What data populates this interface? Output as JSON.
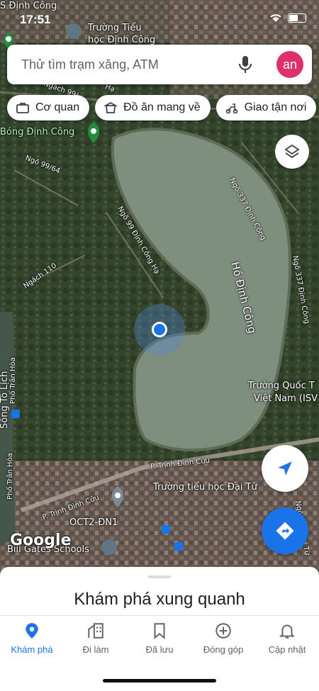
{
  "status_bar": {
    "time": "17:51"
  },
  "search": {
    "placeholder": "Thử tìm trạm xăng, ATM",
    "avatar_initials": "an"
  },
  "chips": [
    {
      "label": "Cơ quan",
      "icon": "briefcase-icon"
    },
    {
      "label": "Đồ ăn mang về",
      "icon": "takeout-icon"
    },
    {
      "label": "Giao tận nơi",
      "icon": "scooter-icon"
    }
  ],
  "map": {
    "labels": {
      "top_street": "S Định Công",
      "school_top": "Trường Tiểu",
      "school_top_2": "học Định Công",
      "ngach_99": "Ngách 99/",
      "ngo_ha": "Hạ",
      "bong_dinh_cong": "Bóng Định Công",
      "ngo_99_64": "Ngõ 99/64",
      "ngo_337_a": "Ngõ 337 Định Công",
      "ngo_99_dinh_cong_ha": "Ngõ 99 Định Công Hạ",
      "ngach_110": "Ngách 110",
      "lake": "Hồ Định Công",
      "ngo_337_b": "Ngõ 337 Định Công",
      "school_intl_1": "Trường Quốc T",
      "school_intl_2": "Việt Nam (ISV",
      "pho_tran_hoa_1": "Phố Trần Hòa",
      "song_to_lich": "Sông Tô Lịch",
      "p_trinh_dinh_cuu_1": "P. Trịnh Đình Cửu",
      "school_dai_tu": "Trường tiểu học Đại Từ",
      "p_trinh_dinh_cuu_2": "P. Trịnh Đình Cửu",
      "pho_tran_hoa_2": "Phố Trần Hòa",
      "oct2": "OCT2-ĐN1",
      "bill_gates": "Bill Gates Schools",
      "ngo_dai_tu": "Ngõ 102 Đại Từ",
      "google": "Google"
    }
  },
  "bottom_sheet": {
    "title": "Khám phá xung quanh"
  },
  "nav": [
    {
      "label": "Khám phá",
      "icon": "explore-pin-icon",
      "active": true
    },
    {
      "label": "Đi làm",
      "icon": "commute-icon",
      "active": false
    },
    {
      "label": "Đã lưu",
      "icon": "bookmark-icon",
      "active": false
    },
    {
      "label": "Đóng góp",
      "icon": "add-circle-icon",
      "active": false
    },
    {
      "label": "Cập nhật",
      "icon": "bell-icon",
      "active": false
    }
  ],
  "colors": {
    "accent": "#1a73e8",
    "avatar": "#e0306a",
    "location_dot": "#1a73e8"
  }
}
